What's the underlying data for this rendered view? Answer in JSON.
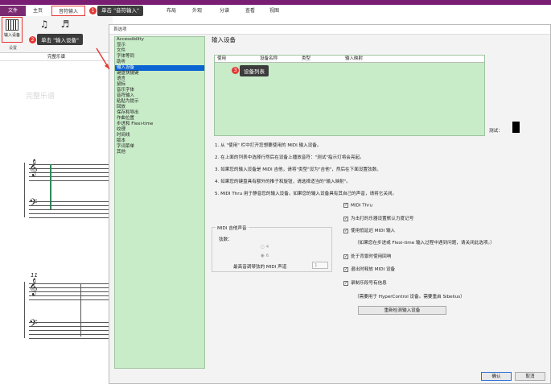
{
  "ribbon": {
    "tabs": [
      "文件",
      "主页",
      "音符输入",
      "单击 \"音符输入\"",
      "布局",
      "外观",
      "分谱",
      "查看",
      "视图"
    ],
    "tool_label": "输入设备",
    "group_label": "设置"
  },
  "callouts": {
    "c1_num": "1",
    "c1_text": "单击 \"音符输入\"",
    "c2_num": "2",
    "c2_text": "单击 \"输入设备\"",
    "c3_num": "3",
    "c3_text": "设备列表"
  },
  "score": {
    "tab_label": "完整乐谱",
    "watermark": "完整乐谱",
    "measure_number": "11"
  },
  "dialog": {
    "title": "首选项",
    "categories": [
      "Accessibility",
      "显示",
      "文件",
      "字体等同",
      "助听",
      "输入设备",
      "键盘快捷键",
      "语言",
      "鼠标",
      "音乐字体",
      "音符输入",
      "粘贴为提示",
      "回放",
      "保存和导出",
      "作曲位置",
      "步进和 Flexi-time",
      "纹理",
      "时间线",
      "版本",
      "字词菜单",
      "其他"
    ],
    "selected_category": "输入设备",
    "section_title": "输入设备",
    "table_headers": [
      "使用",
      "设备名称",
      "类型",
      "输入映射"
    ],
    "test_label": "测试：",
    "instructions": [
      "1. 从 \"使用\" 栏中打开您想要使用的 MIDI 输入设备。",
      "2. 在上面的列表中选择行然后在设备上播放音符：\"测试\"指示灯将会亮起。",
      "3. 如果您的输入设备是 MIDI 吉他，请将\"类型\"设为\"吉他\"，然后在下面设置弦数。",
      "4. 如果您的键盘具有额外的推子和旋钮，请选择适当的\"输入映射\"。",
      "5. MIDI Thru 用于静音您的输入设备。如果您的输入设备具有其自己的声音，请将它关闭。"
    ],
    "guitar_group": {
      "legend": "MIDI 吉他声音",
      "strings_label": "弦数：",
      "opt_4": "4",
      "opt_6": "6",
      "min_channel_label": "最高音调琴弦的 MIDI 声道",
      "min_channel_value": "1"
    },
    "checkboxes": [
      {
        "label": "MIDI Thru",
        "checked": "✓"
      },
      {
        "label": "为击打的乐器设置默认力度记号",
        "checked": "✓"
      },
      {
        "label": "使用低延迟 MIDI 输入",
        "checked": "✓"
      },
      {
        "label": "处于背景时使用回响",
        "checked": "✓"
      },
      {
        "label": "退出时释放 MIDI 设备",
        "checked": "✓"
      },
      {
        "label": "录制乐段号有信息",
        "checked": "✓"
      }
    ],
    "note_low_latency": "（如果您在步进或 Flexi-time 输入过程中遇到问题，请关闭此选项。）",
    "note_hypercontrol": "（需要用于 HyperControl 设备。需要重启 Sibelius）",
    "rescan_button": "重新检测输入设备",
    "ok_button": "确认",
    "cancel_button": "取消"
  }
}
